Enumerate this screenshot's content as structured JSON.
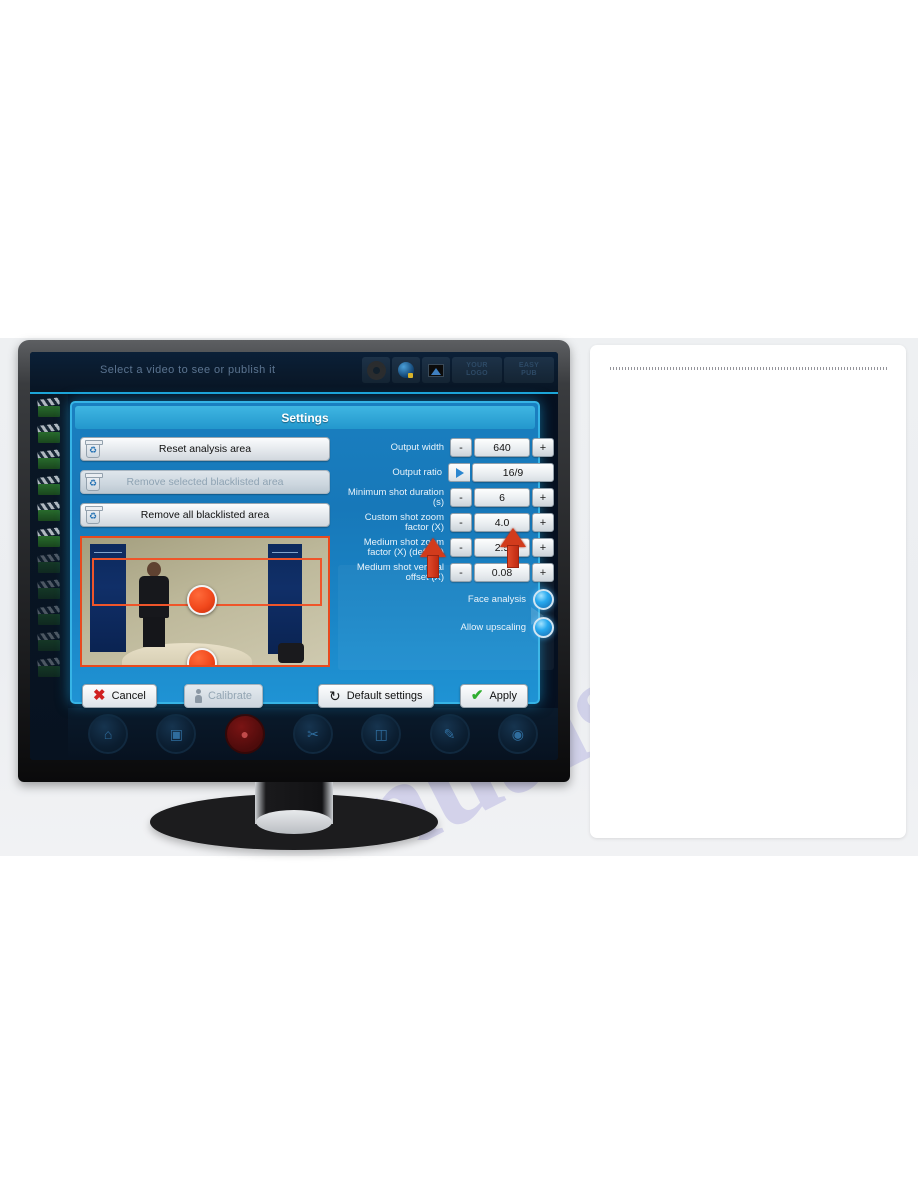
{
  "watermark": {
    "text": "manualslib.com"
  },
  "app": {
    "header_title": "Select a video to see or publish it",
    "toolbar": [
      {
        "name": "gear-icon",
        "label": ""
      },
      {
        "name": "globe-icon",
        "label": ""
      },
      {
        "name": "picture-icon",
        "label": ""
      },
      {
        "name": "mode-button-1",
        "label": "YOUR\nLOGO"
      },
      {
        "name": "mode-button-2",
        "label": "EASY\nPUB"
      }
    ]
  },
  "dialog": {
    "title": "Settings",
    "left_buttons": [
      {
        "label": "Reset analysis area",
        "icon": "trash-icon",
        "disabled": false
      },
      {
        "label": "Remove selected blacklisted area",
        "icon": "trash-icon",
        "disabled": true
      },
      {
        "label": "Remove all blacklisted area",
        "icon": "trash-icon",
        "disabled": false
      }
    ],
    "fields": [
      {
        "label": "Output width",
        "value": "640",
        "minus": "-",
        "plus": "+",
        "type": "stepper"
      },
      {
        "label": "Output ratio",
        "value": "16/9",
        "type": "play"
      },
      {
        "label": "Minimum shot duration (s)",
        "value": "6",
        "minus": "-",
        "plus": "+",
        "type": "stepper"
      },
      {
        "label": "Custom shot zoom factor (X)",
        "value": "4.0",
        "minus": "-",
        "plus": "+",
        "type": "stepper"
      },
      {
        "label": "Medium shot zoom factor (X) (default)",
        "value": "2.5",
        "minus": "-",
        "plus": "+",
        "type": "stepper"
      },
      {
        "label": "Medium shot vertical offset (X)",
        "value": "0.08",
        "minus": "-",
        "plus": "+",
        "type": "stepper"
      }
    ],
    "toggles": [
      {
        "label": "Face analysis",
        "state": "on"
      },
      {
        "label": "Allow upscaling",
        "state": "on"
      }
    ],
    "footer": {
      "cancel": "Cancel",
      "calibrate": "Calibrate",
      "default_settings": "Default settings",
      "apply": "Apply"
    }
  },
  "colors": {
    "dialog_blue": "#1a7fc0",
    "title_blue": "#3fb6e2",
    "accent_cyan": "#36b4e6",
    "annotation_red": "#d23b1c",
    "preview_rect_orange": "#e84a1e",
    "cancel_x": "#d02020",
    "apply_check": "#2fae2f"
  }
}
